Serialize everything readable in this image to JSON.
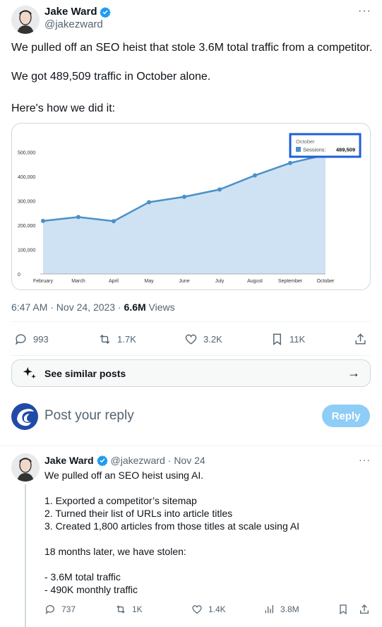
{
  "tweet": {
    "author": {
      "name": "Jake Ward",
      "handle": "@jakezward"
    },
    "more_label": "···",
    "text_lines": [
      "We pulled off an SEO heist that stole 3.6M total traffic from a competitor.",
      "We got 489,509 traffic in October alone.",
      "Here's how we did it:"
    ],
    "timestamp": "6:47 AM · Nov 24, 2023 · ",
    "views_count": "6.6M",
    "views_label": " Views",
    "actions": {
      "replies": "993",
      "reposts": "1.7K",
      "likes": "3.2K",
      "bookmarks": "11K"
    }
  },
  "chart_data": {
    "type": "area",
    "categories": [
      "February",
      "March",
      "April",
      "May",
      "June",
      "July",
      "August",
      "September",
      "October"
    ],
    "series": [
      {
        "name": "Sessions",
        "values": [
          218000,
          234000,
          217000,
          295000,
          317000,
          347000,
          405000,
          456000,
          489509
        ]
      }
    ],
    "y_ticks": [
      "0",
      "100,000",
      "200,000",
      "300,000",
      "400,000",
      "500,000"
    ],
    "ylim": [
      0,
      560000
    ],
    "tooltip": {
      "title": "October",
      "label": "Sessions: ",
      "value": "489,509"
    },
    "colors": {
      "line": "#4a90c8",
      "fill": "#cfe2f3",
      "tooltip_border": "#1d5fd6"
    }
  },
  "similar": {
    "label": "See similar posts"
  },
  "composer": {
    "placeholder": "Post your reply",
    "button": "Reply"
  },
  "reply": {
    "author": {
      "name": "Jake Ward",
      "handle": "@jakezward",
      "date": " · Nov 24"
    },
    "body": "We pulled off an SEO heist using AI.\n\n1. Exported a competitor’s sitemap\n2. Turned their list of URLs into article titles\n3. Created 1,800 articles from those titles at scale using AI\n\n18 months later, we have stolen:\n\n- 3.6M total traffic\n- 490K monthly traffic",
    "actions": {
      "replies": "737",
      "reposts": "1K",
      "likes": "1.4K",
      "views": "3.8M"
    }
  },
  "colors": {
    "accent": "#1d9bf0",
    "muted": "#536471",
    "reply_button": "#8ecdf7"
  }
}
